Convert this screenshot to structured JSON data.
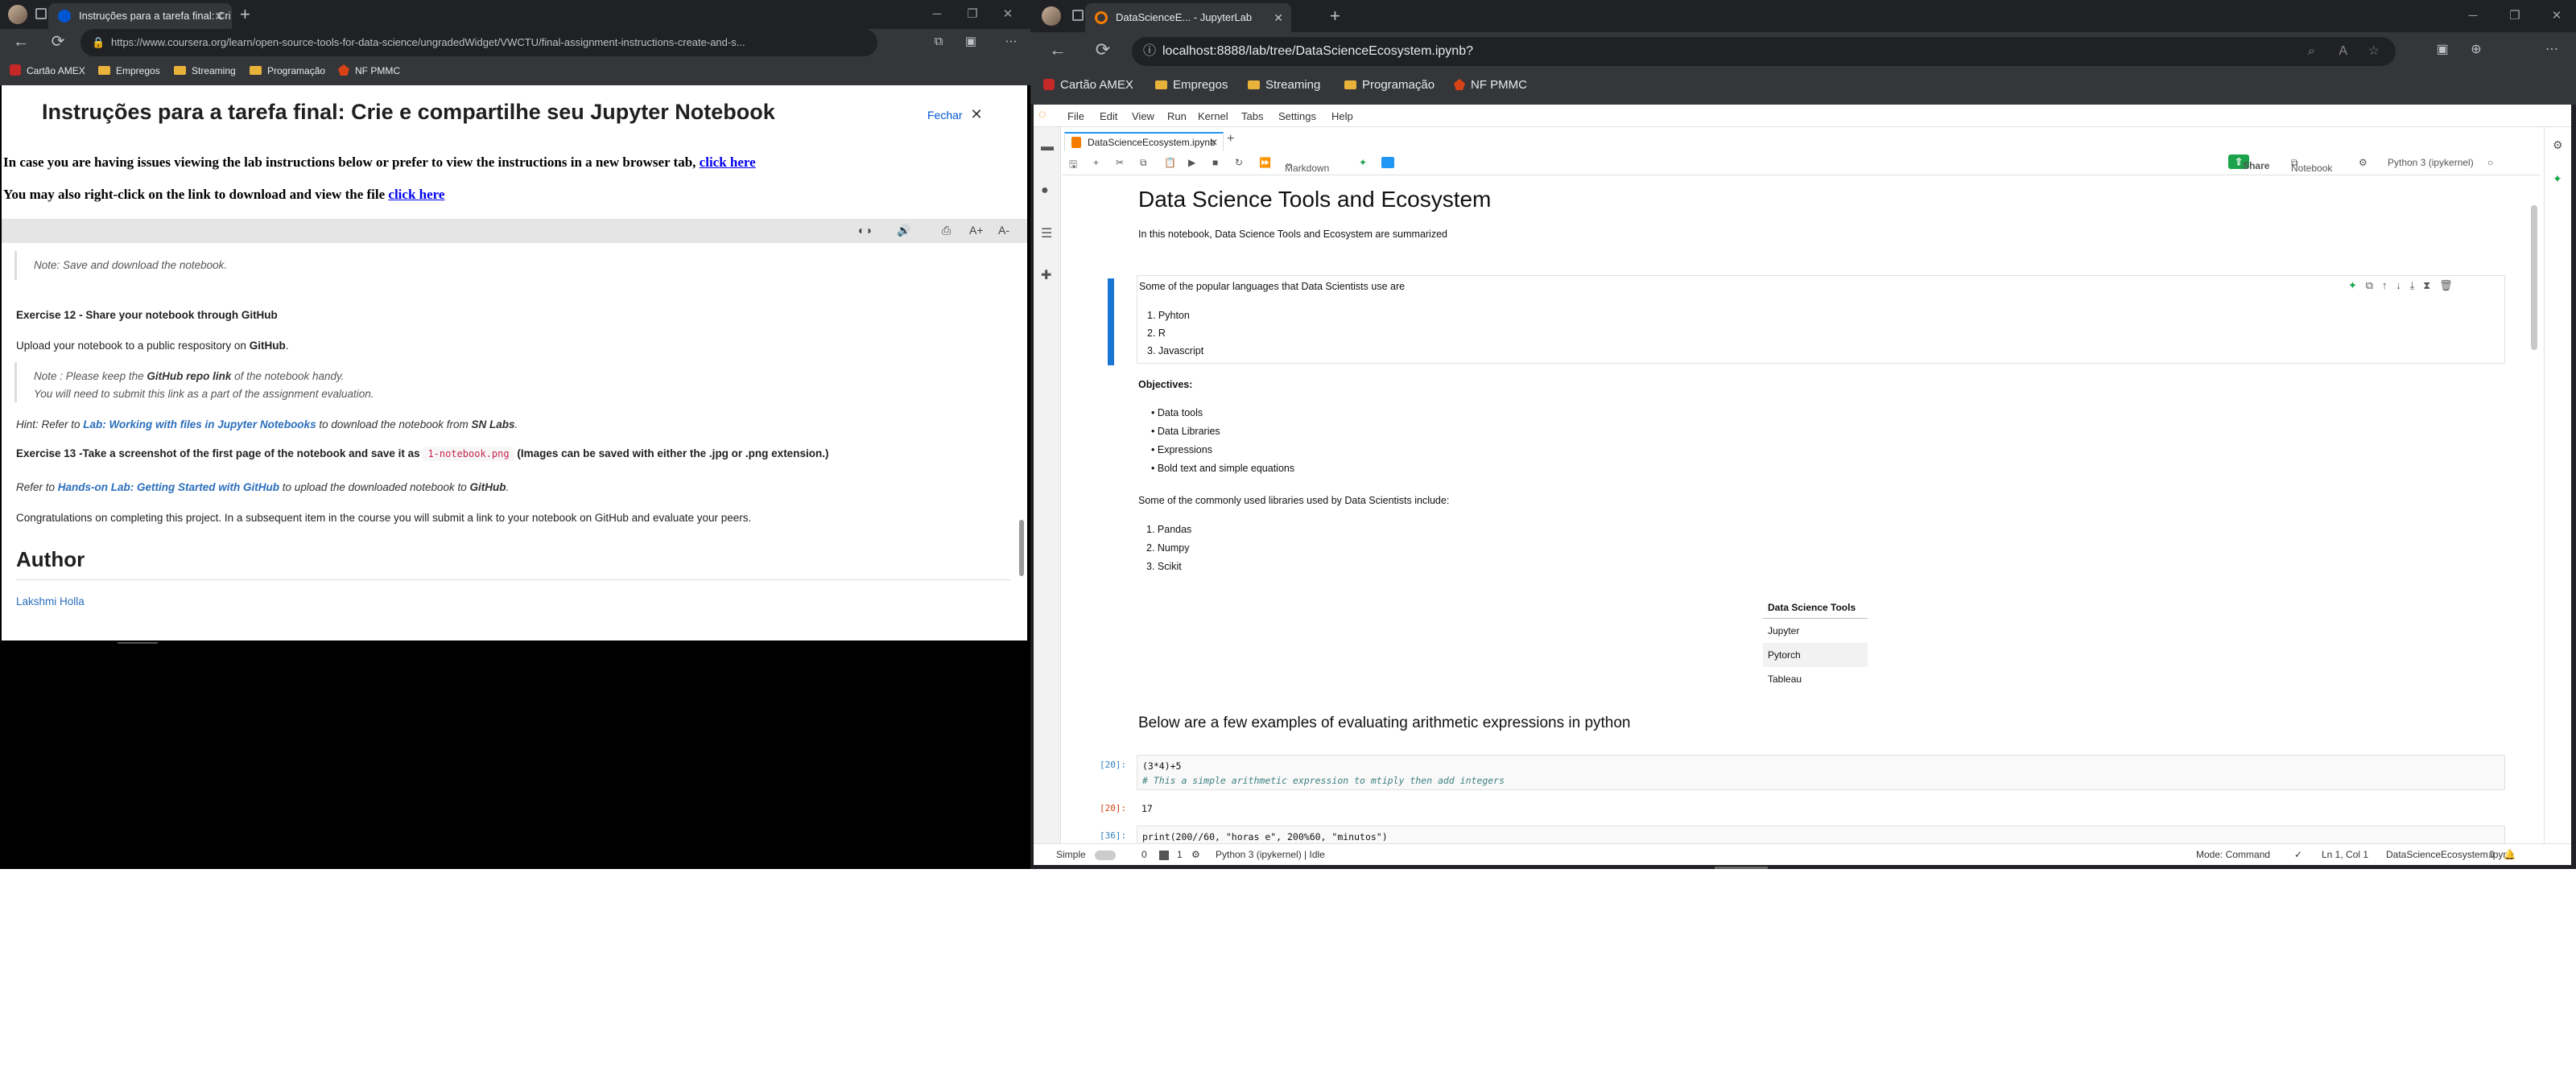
{
  "left_browser": {
    "tab_title": "Instruções para a tarefa final: Cri",
    "new_tab": "+",
    "url": "https://www.coursera.org/learn/open-source-tools-for-data-science/ungradedWidget/VWCTU/final-assignment-instructions-create-and-s...",
    "bookmarks": [
      "Cartão AMEX",
      "Empregos",
      "Streaming",
      "Programação",
      "NF PMMC"
    ],
    "page": {
      "title": "Instruções para a tarefa final: Crie e compartilhe seu Jupyter Notebook",
      "close_label": "Fechar",
      "issue_text": "In case you are having issues viewing the lab instructions below or prefer to view the instructions in a new browser tab,",
      "issue_link": "click here",
      "download_text": "You may also right-click on the link to download and view the file",
      "download_link": "click here",
      "note1": "Note: Save and download the notebook.",
      "ex12_title": "Exercise 12 - Share your notebook through GitHub",
      "upload_pre": "Upload your notebook to a public respository on",
      "upload_bold": "GitHub",
      "upload_post": ".",
      "note2_pre": "Note : Please keep the",
      "note2_bold": "GitHub repo link",
      "note2_post": "of the notebook handy.",
      "note2_line2": "You will need to submit this link as a part of the assignment evaluation.",
      "hint_pre": "Hint: Refer to",
      "hint_link": "Lab: Working with files in Jupyter Notebooks",
      "hint_mid": "to download the notebook from",
      "hint_bold": "SN Labs",
      "hint_post": ".",
      "ex13_pre": "Exercise 13 -Take a screenshot of the first page of the notebook and save it as",
      "ex13_code": "1-notebook.png",
      "ex13_post": "(Images can be saved with either the .jpg or .png extension.)",
      "refer_pre": "Refer to",
      "refer_link": "Hands-on Lab: Getting Started with GitHub",
      "refer_mid": "to upload the downloaded notebook to",
      "refer_bold": "GitHub",
      "refer_post": ".",
      "congrats": "Congratulations on completing this project. In a subsequent item in the course you will submit a link to your notebook on GitHub and evaluate your peers.",
      "author_heading": "Author",
      "author_name": "Lakshmi Holla"
    }
  },
  "right_browser": {
    "tab_title": "DataScienceE... - JupyterLab",
    "new_tab": "+",
    "url": "localhost:8888/lab/tree/DataScienceEcosystem.ipynb?",
    "bookmarks": [
      "Cartão AMEX",
      "Empregos",
      "Streaming",
      "Programação",
      "NF PMMC"
    ]
  },
  "jupyter": {
    "menu": [
      "File",
      "Edit",
      "View",
      "Run",
      "Kernel",
      "Tabs",
      "Settings",
      "Help"
    ],
    "doc_tab": "DataScienceEcosystem.ipynb",
    "cell_type": "Markdown",
    "share": "Share",
    "notebook_label": "Notebook",
    "kernel": "Python 3 (ipykernel)",
    "h1": "Data Science Tools and Ecosystem",
    "intro": "In this notebook, Data Science Tools and Ecosystem are summarized",
    "langs_intro": "Some of the popular languages that Data Scientists use are",
    "langs": [
      "Pyhton",
      "R",
      "Javascript"
    ],
    "objectives_label": "Objectives:",
    "objectives": [
      "Data tools",
      "Data Libraries",
      "Expressions",
      "Bold text and simple equations"
    ],
    "libs_intro": "Some of the commonly used libraries used by Data Scientists include:",
    "libs": [
      "Pandas",
      "Numpy",
      "Scikit"
    ],
    "table_header": "Data Science Tools",
    "tools": [
      "Jupyter",
      "Pytorch",
      "Tableau"
    ],
    "h2": "Below are a few examples of evaluating arithmetic expressions in python",
    "cell1_prompt": "[20]:",
    "cell1_line1": "(3*4)+5",
    "cell1_line2": "# This a simple arithmetic expression to mtiply then add integers",
    "out1_prompt": "[20]:",
    "out1": "17",
    "cell2_prompt": "[36]:",
    "cell2_code": "print(200//60, \"horas e\", 200%60, \"minutos\")",
    "status": {
      "simple": "Simple",
      "zero": "0",
      "one": "1",
      "kernel_idle": "Python 3 (ipykernel) | Idle",
      "mode": "Mode: Command",
      "position": "Ln 1, Col 1",
      "file": "DataScienceEcosystem.ipynb",
      "count": "0"
    }
  }
}
